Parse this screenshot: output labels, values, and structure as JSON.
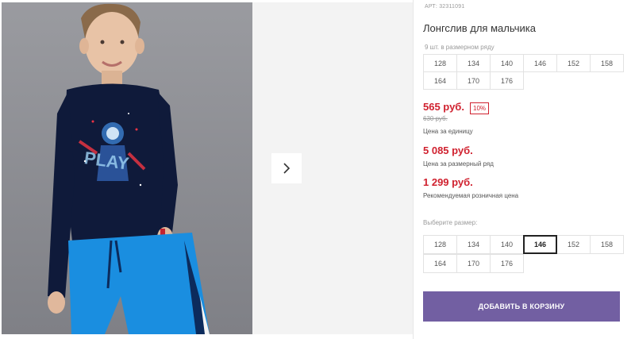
{
  "product": {
    "sku": "АРТ: 32311091",
    "title": "Лонгслив для мальчика",
    "pack_label": "9 шт. в размерном ряду",
    "pack_sizes": [
      "128",
      "134",
      "140",
      "146",
      "152",
      "158",
      "164",
      "170",
      "176"
    ],
    "price_unit": "565 руб.",
    "discount": "10%",
    "old_price": "630 руб.",
    "price_unit_caption": "Цена за единицу",
    "price_pack": "5 085 руб.",
    "price_pack_caption": "Цена за размерный ряд",
    "price_retail": "1 299 руб.",
    "price_retail_caption": "Рекомендуемая розничная цена",
    "choose_size_label": "Выберите размер:",
    "sizes": [
      "128",
      "134",
      "140",
      "146",
      "152",
      "158",
      "164",
      "170",
      "176"
    ],
    "selected_size": "146",
    "add_to_cart": "Добавить в корзину"
  },
  "gallery": {
    "shirt_print": "PLAY",
    "next_icon": "chevron-right-icon"
  },
  "colors": {
    "accent": "#725fa2",
    "price": "#d0212f",
    "shirt": "#0f1a3a",
    "pants": "#1a8ee0"
  }
}
